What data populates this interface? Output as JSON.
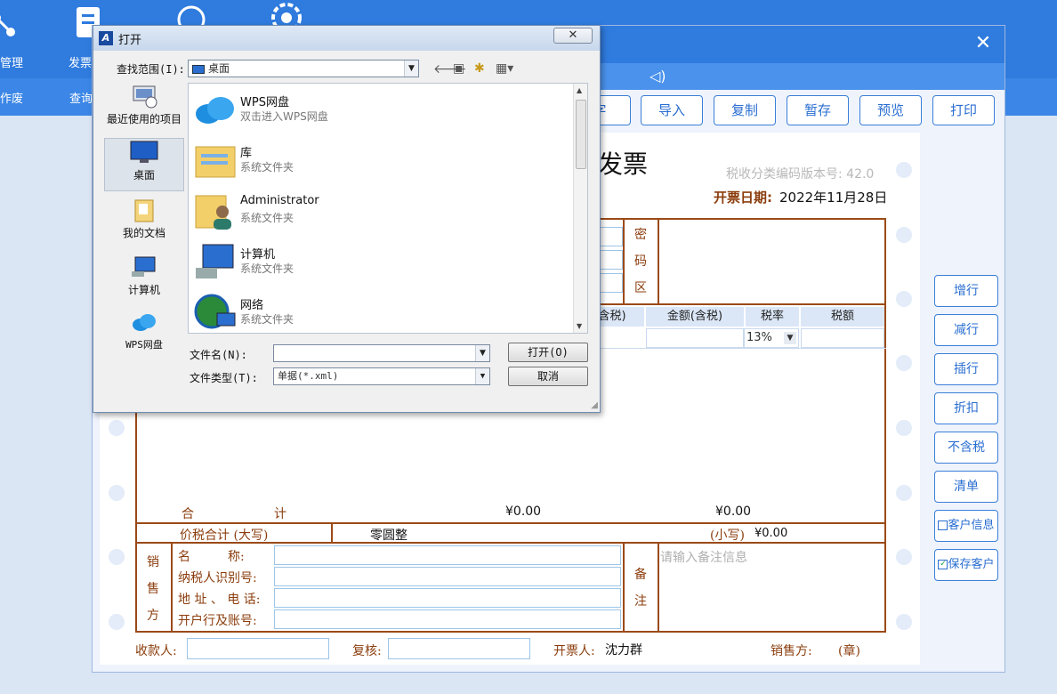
{
  "topbar": {
    "items": [
      {
        "label": "管理"
      },
      {
        "label": "发票"
      }
    ],
    "row2": [
      {
        "label": "作废"
      },
      {
        "label": "查询"
      }
    ]
  },
  "window": {
    "close_label": "✕"
  },
  "actions": {
    "partial_label": "字",
    "import_label": "导入",
    "copy_label": "复制",
    "save_draft_label": "暂存",
    "preview_label": "预览",
    "print_label": "打印"
  },
  "side_buttons": {
    "add_row": "增行",
    "remove_row": "减行",
    "insert_row": "插行",
    "discount": "折扣",
    "tax_exclusive": "不含税",
    "clear": "清单",
    "customer_info": "客户信息",
    "save_customer": "保存客户"
  },
  "invoice": {
    "title": "发票",
    "version": "税收分类编码版本号: 42.0",
    "date_label": "开票日期:",
    "date_value": "2022年11月28日",
    "cipher_label": [
      "密",
      "码",
      "区"
    ],
    "columns": {
      "price_incl": "含税)",
      "amount_incl": "金额(含税)",
      "tax_rate": "税率",
      "tax": "税额"
    },
    "tax_rate_value": "13%",
    "total_label_1": "合",
    "total_label_2": "计",
    "total_amount": "¥0.00",
    "total_tax": "¥0.00",
    "grand_total_label": "价税合计 (大写)",
    "grand_total_words": "零圆整",
    "grand_total_small_label": "(小写)",
    "grand_total_small_value": "¥0.00",
    "seller_label": [
      "销",
      "售",
      "方"
    ],
    "seller_name_label": "名　　　称:",
    "seller_taxid_label": "纳税人识别号:",
    "seller_addr_label": "地 址 、 电 话:",
    "seller_bank_label": "开户行及账号:",
    "remark_label": [
      "备",
      "注"
    ],
    "remark_placeholder": "请输入备注信息",
    "payee_label": "收款人:",
    "reviewer_label": "复核:",
    "drawer_label": "开票人:",
    "drawer_value": "沈力群",
    "seller_stamp_label": "销售方:",
    "stamp_label": "(章)"
  },
  "dialog": {
    "title": "打开",
    "lookin_label": "查找范围(I):",
    "lookin_value": "桌面",
    "places": [
      {
        "label": "最近使用的项目"
      },
      {
        "label": "桌面"
      },
      {
        "label": "我的文档"
      },
      {
        "label": "计算机"
      },
      {
        "label": "WPS网盘"
      }
    ],
    "files": [
      {
        "name": "WPS网盘",
        "desc": "双击进入WPS网盘"
      },
      {
        "name": "库",
        "desc": "系统文件夹"
      },
      {
        "name": "Administrator",
        "desc": "系统文件夹"
      },
      {
        "name": "计算机",
        "desc": "系统文件夹"
      },
      {
        "name": "网络",
        "desc": "系统文件夹"
      }
    ],
    "filename_label": "文件名(N):",
    "filename_value": "",
    "filetype_label": "文件类型(T):",
    "filetype_value": "单据(*.xml)",
    "open_button": "打开(O)",
    "cancel_button": "取消"
  }
}
